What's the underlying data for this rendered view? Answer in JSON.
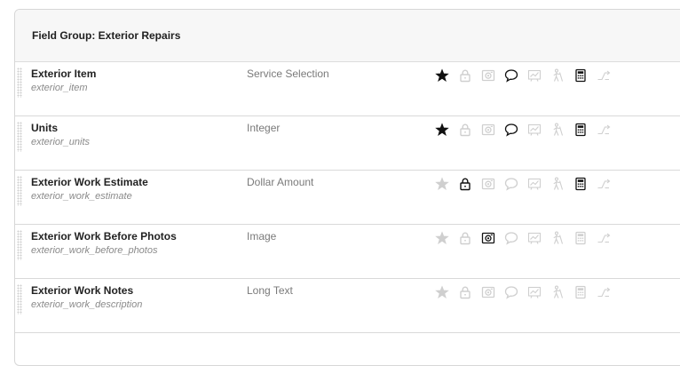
{
  "group": {
    "title": "Field Group: Exterior Repairs"
  },
  "rows": [
    {
      "name": "Exterior Item",
      "key": "exterior_item",
      "type": "Service Selection",
      "flags": {
        "required": true,
        "locked": false,
        "photo": false,
        "comment": true,
        "chart": false,
        "person": false,
        "calculator": true,
        "flow": false
      }
    },
    {
      "name": "Units",
      "key": "exterior_units",
      "type": "Integer",
      "flags": {
        "required": true,
        "locked": false,
        "photo": false,
        "comment": true,
        "chart": false,
        "person": false,
        "calculator": true,
        "flow": false
      }
    },
    {
      "name": "Exterior Work Estimate",
      "key": "exterior_work_estimate",
      "type": "Dollar Amount",
      "flags": {
        "required": false,
        "locked": true,
        "photo": false,
        "comment": false,
        "chart": false,
        "person": false,
        "calculator": true,
        "flow": false
      }
    },
    {
      "name": "Exterior Work Before Photos",
      "key": "exterior_work_before_photos",
      "type": "Image",
      "flags": {
        "required": false,
        "locked": false,
        "photo": true,
        "comment": false,
        "chart": false,
        "person": false,
        "calculator": false,
        "flow": false
      }
    },
    {
      "name": "Exterior Work Notes",
      "key": "exterior_work_description",
      "type": "Long Text",
      "flags": {
        "required": false,
        "locked": false,
        "photo": false,
        "comment": false,
        "chart": false,
        "person": false,
        "calculator": false,
        "flow": false
      }
    }
  ],
  "icons": [
    "star-icon",
    "lock-icon",
    "camera-icon",
    "comment-icon",
    "chart-icon",
    "person-icon",
    "calculator-icon",
    "flow-icon"
  ],
  "colors": {
    "active": "#111111",
    "inactive": "#cfcfcf",
    "header_bg": "#f7f7f7"
  }
}
